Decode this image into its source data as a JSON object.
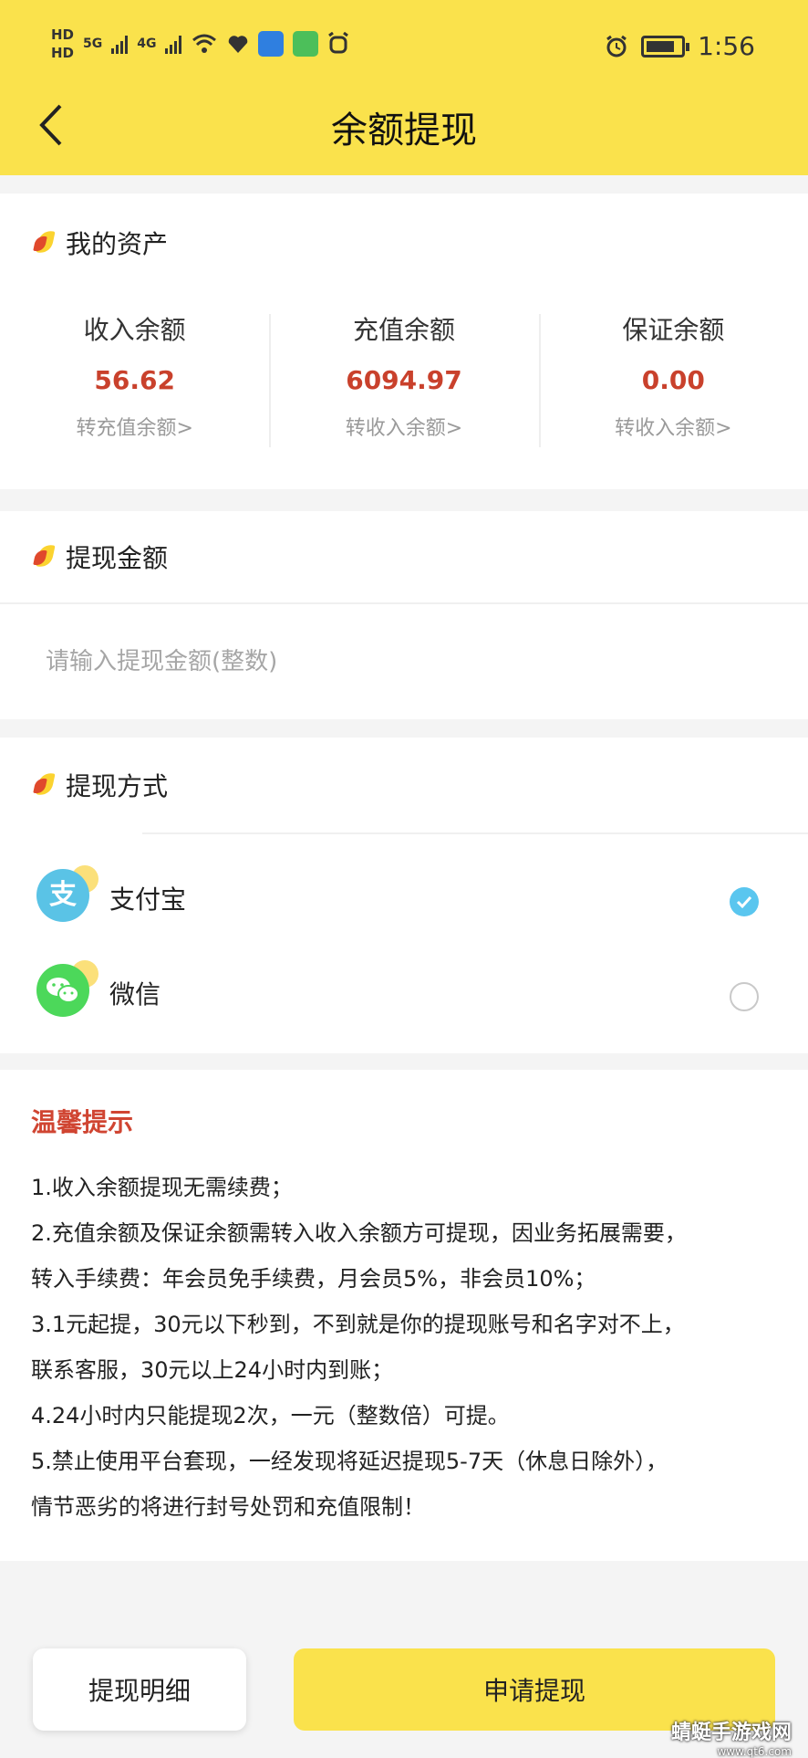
{
  "status_bar": {
    "hd_top": "HD",
    "hd_bottom": "HD",
    "net_5g": "5G",
    "net_4g": "4G",
    "time": "1:56"
  },
  "header": {
    "title": "余额提现"
  },
  "assets": {
    "title": "我的资产",
    "items": [
      {
        "label": "收入余额",
        "value": "56.62",
        "link": "转充值余额>"
      },
      {
        "label": "充值余额",
        "value": "6094.97",
        "link": "转收入余额>"
      },
      {
        "label": "保证余额",
        "value": "0.00",
        "link": "转收入余额>"
      }
    ]
  },
  "amount": {
    "title": "提现金额",
    "placeholder": "请输入提现金额(整数)",
    "value": ""
  },
  "method": {
    "title": "提现方式",
    "options": [
      {
        "label": "支付宝",
        "glyph": "支",
        "icon": "alipay-icon",
        "color": "#5ac3e6",
        "selected": true
      },
      {
        "label": "微信",
        "icon": "wechat-icon",
        "color": "#4cd85a",
        "selected": false
      }
    ]
  },
  "tips": {
    "title": "温馨提示",
    "lines": [
      "1.收入余额提现无需续费；",
      "2.充值余额及保证余额需转入收入余额方可提现，因业务拓展需要，",
      "转入手续费：年会员免手续费，月会员5%，非会员10%；",
      "3.1元起提，30元以下秒到，不到就是你的提现账号和名字对不上，",
      "联系客服，30元以上24小时内到账；",
      "4.24小时内只能提现2次，一元（整数倍）可提。",
      "5.禁止使用平台套现，一经发现将延迟提现5-7天（休息日除外），",
      "情节恶劣的将进行封号处罚和充值限制！"
    ]
  },
  "footer": {
    "detail_label": "提现明细",
    "apply_label": "申请提现"
  },
  "watermark": {
    "line1": "蜻蜓手游戏网",
    "line2": "www.qt6.com"
  },
  "colors": {
    "brand_yellow": "#fae24c",
    "amount_red": "#c9412c",
    "tips_red": "#d04532",
    "check_blue": "#5ac6ef"
  }
}
